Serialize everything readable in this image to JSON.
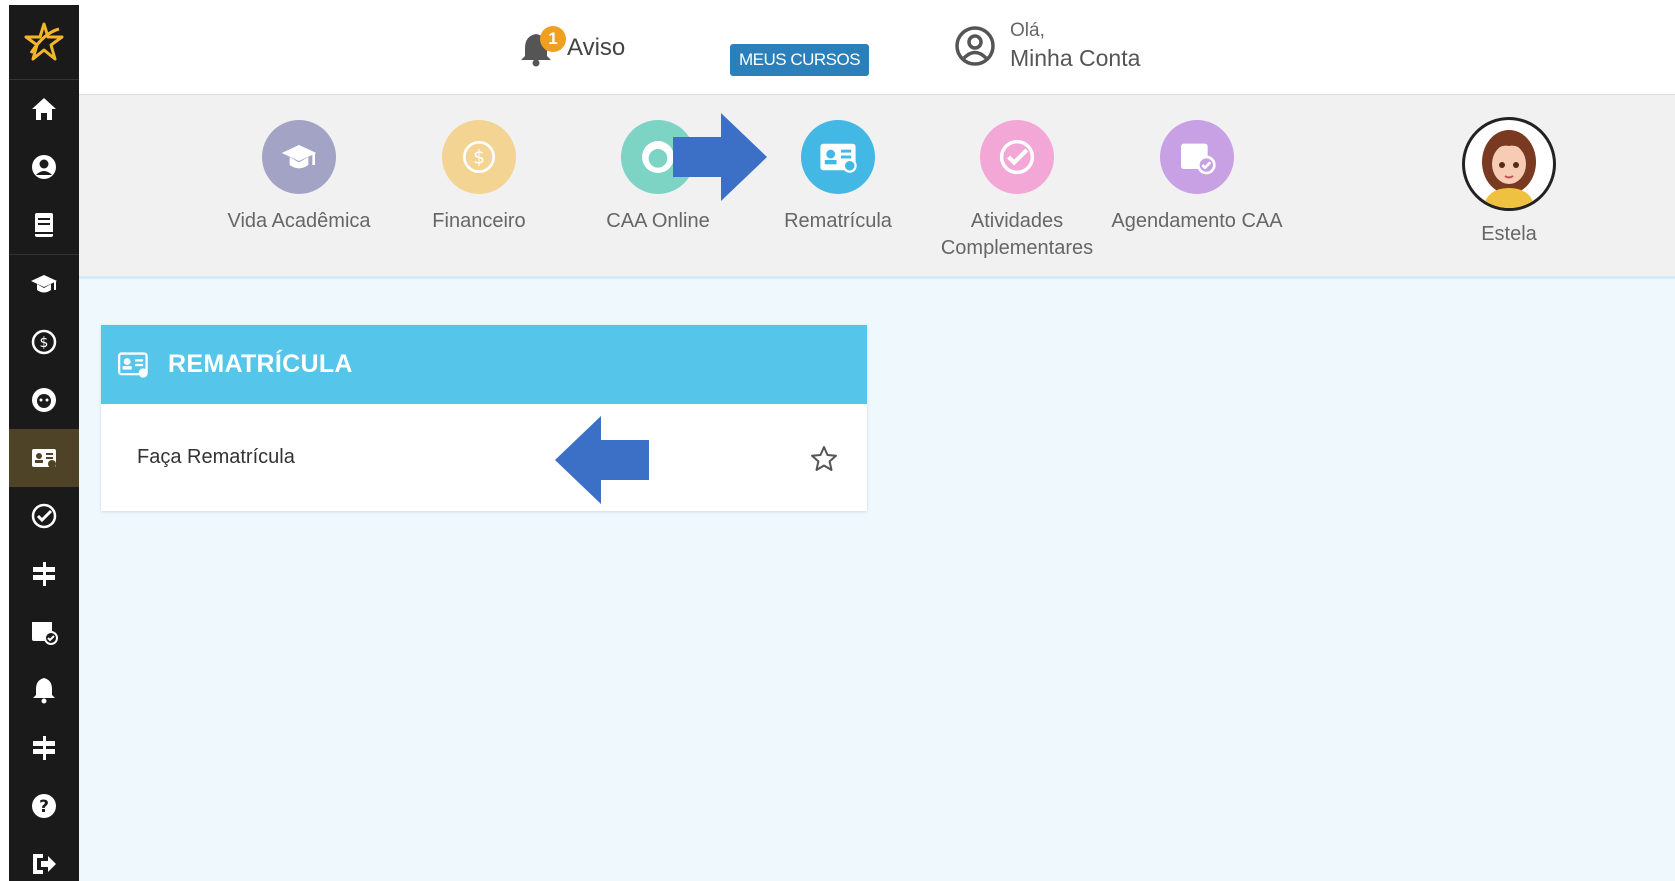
{
  "sidebar": {
    "logo": "star-logo",
    "items": [
      {
        "icon": "home-icon"
      },
      {
        "icon": "user-circle-icon"
      },
      {
        "icon": "book-icon"
      },
      {
        "icon": "graduation-cap-icon"
      },
      {
        "icon": "dollar-circle-icon"
      },
      {
        "icon": "support-face-icon"
      },
      {
        "icon": "id-card-icon",
        "active": true
      },
      {
        "icon": "check-circle-icon"
      },
      {
        "icon": "signpost-icon"
      },
      {
        "icon": "calendar-check-icon"
      },
      {
        "icon": "bell-icon"
      },
      {
        "icon": "signpost-icon"
      },
      {
        "icon": "help-icon"
      },
      {
        "icon": "logout-icon"
      }
    ]
  },
  "header": {
    "aviso_label": "Aviso",
    "aviso_count": "1",
    "meus_cursos_label": "MEUS CURSOS",
    "greeting": "Olá,",
    "account_label": "Minha Conta"
  },
  "modules": [
    {
      "label": "Vida Acadêmica",
      "color": "#a2a3c5",
      "icon": "graduation-cap-icon"
    },
    {
      "label": "Financeiro",
      "color": "#f3d493",
      "icon": "dollar-circle-icon"
    },
    {
      "label": "CAA Online",
      "color": "#7dd3c4",
      "icon": "support-face-icon"
    },
    {
      "label": "Rematrícula",
      "color": "#43b8e4",
      "icon": "id-card-icon"
    },
    {
      "label": "Atividades Complementares",
      "color": "#f2a7d6",
      "icon": "check-circle-icon"
    },
    {
      "label": "Agendamento CAA",
      "color": "#c7a1e4",
      "icon": "calendar-check-icon"
    }
  ],
  "profile": {
    "name": "Estela"
  },
  "card": {
    "title": "REMATRÍCULA",
    "items": [
      {
        "label": "Faça Rematrícula",
        "favorite": false
      }
    ]
  },
  "colors": {
    "sidebar_bg": "#1a1a1a",
    "accent_blue": "#56c5ea",
    "button_blue": "#2b80b9",
    "badge_orange": "#f0a020",
    "arrow_blue": "#3c6fc6"
  }
}
